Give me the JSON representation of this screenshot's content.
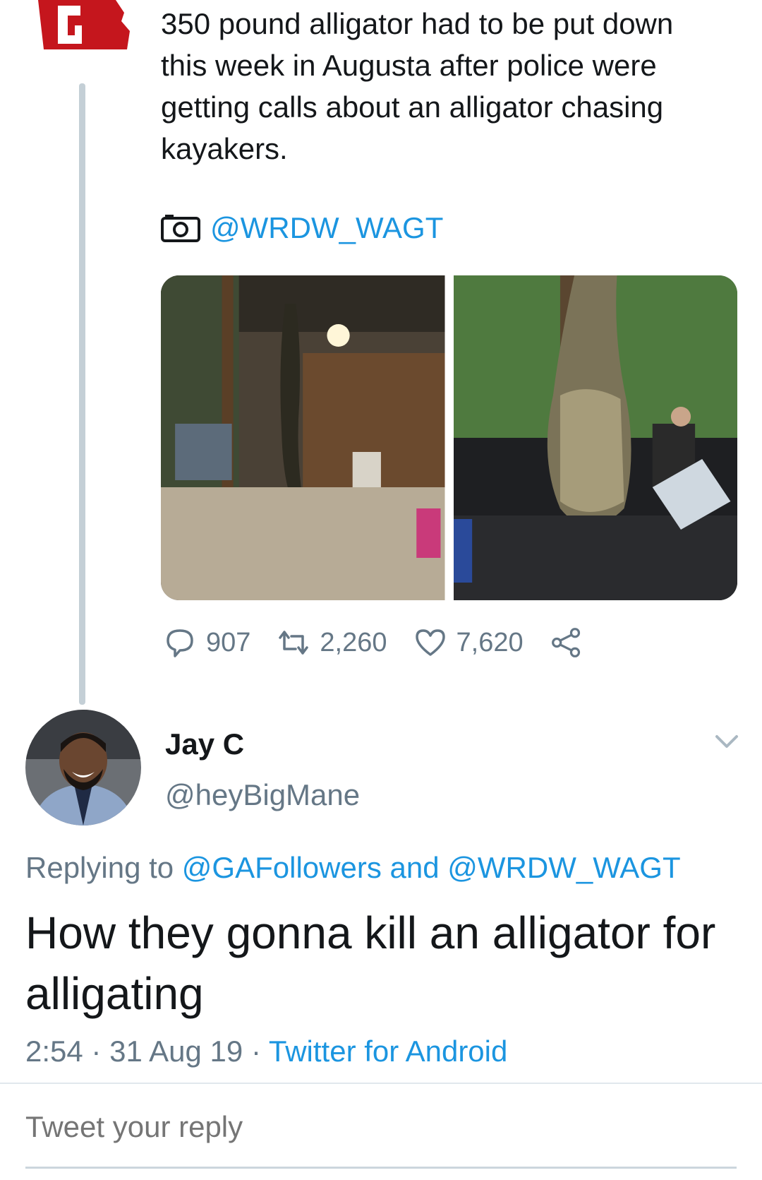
{
  "tweet": {
    "text": "350 pound alligator had to be put down this week in Augusta after police were getting calls about an alligator chasing kayakers.",
    "photo_credit": "@WRDW_WAGT",
    "stats": {
      "replies": "907",
      "retweets": "2,260",
      "likes": "7,620"
    }
  },
  "reply": {
    "display_name": "Jay C",
    "handle": "@heyBigMane",
    "replying_prefix": "Replying to",
    "replying_mention_1": "@GAFollowers",
    "replying_and": "and",
    "replying_mention_2": "@WRDW_WAGT",
    "text": "How they gonna kill an alligator for alligating",
    "time": "2:54",
    "date": "31 Aug 19",
    "separator": "·",
    "source": "Twitter for Android"
  },
  "composer": {
    "placeholder": "Tweet your reply"
  },
  "colors": {
    "link": "#1b95e0",
    "secondary_text": "#657786",
    "logo_red": "#c5161d",
    "thread_line": "#c4cfd6"
  },
  "icons": [
    "georgia-logo-icon",
    "camera-icon",
    "reply-icon",
    "retweet-icon",
    "like-icon",
    "share-icon",
    "chevron-down-icon"
  ]
}
